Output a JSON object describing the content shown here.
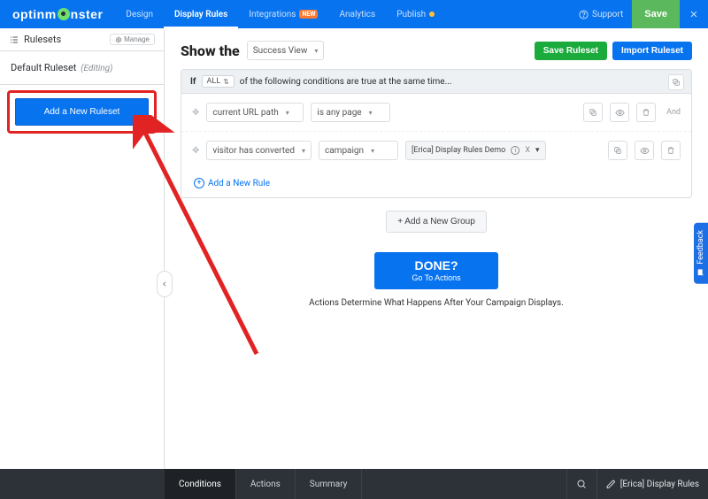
{
  "brand": "optinmonster",
  "nav": {
    "design": "Design",
    "display_rules": "Display Rules",
    "integrations": "Integrations",
    "integrations_badge": "NEW",
    "analytics": "Analytics",
    "publish": "Publish"
  },
  "topbar": {
    "support": "Support",
    "save": "Save"
  },
  "sidebar": {
    "title": "Rulesets",
    "manage": "Manage",
    "default_ruleset": "Default Ruleset",
    "editing": "(Editing)",
    "add_ruleset": "Add a New Ruleset"
  },
  "page": {
    "show_the": "Show the",
    "view_dd": "Success View"
  },
  "actions": {
    "save_ruleset": "Save Ruleset",
    "import_ruleset": "Import Ruleset"
  },
  "if_bar": {
    "if": "If",
    "chip": "ALL",
    "text": "of the following conditions are true at the same time..."
  },
  "rule1": {
    "field": "current URL path",
    "op": "is any page",
    "and": "And"
  },
  "rule2": {
    "field": "visitor has converted",
    "op": "campaign",
    "token": "[Erica] Display Rules Demo",
    "token_x": "X"
  },
  "links": {
    "add_rule": "Add a New Rule",
    "add_group": "+ Add a New Group"
  },
  "done": {
    "big": "DONE?",
    "sub": "Go To Actions"
  },
  "caption": "Actions Determine What Happens After Your Campaign Displays.",
  "footer": {
    "conditions": "Conditions",
    "actions": "Actions",
    "summary": "Summary",
    "campaign": "[Erica] Display Rules"
  },
  "feedback": "Feedback"
}
